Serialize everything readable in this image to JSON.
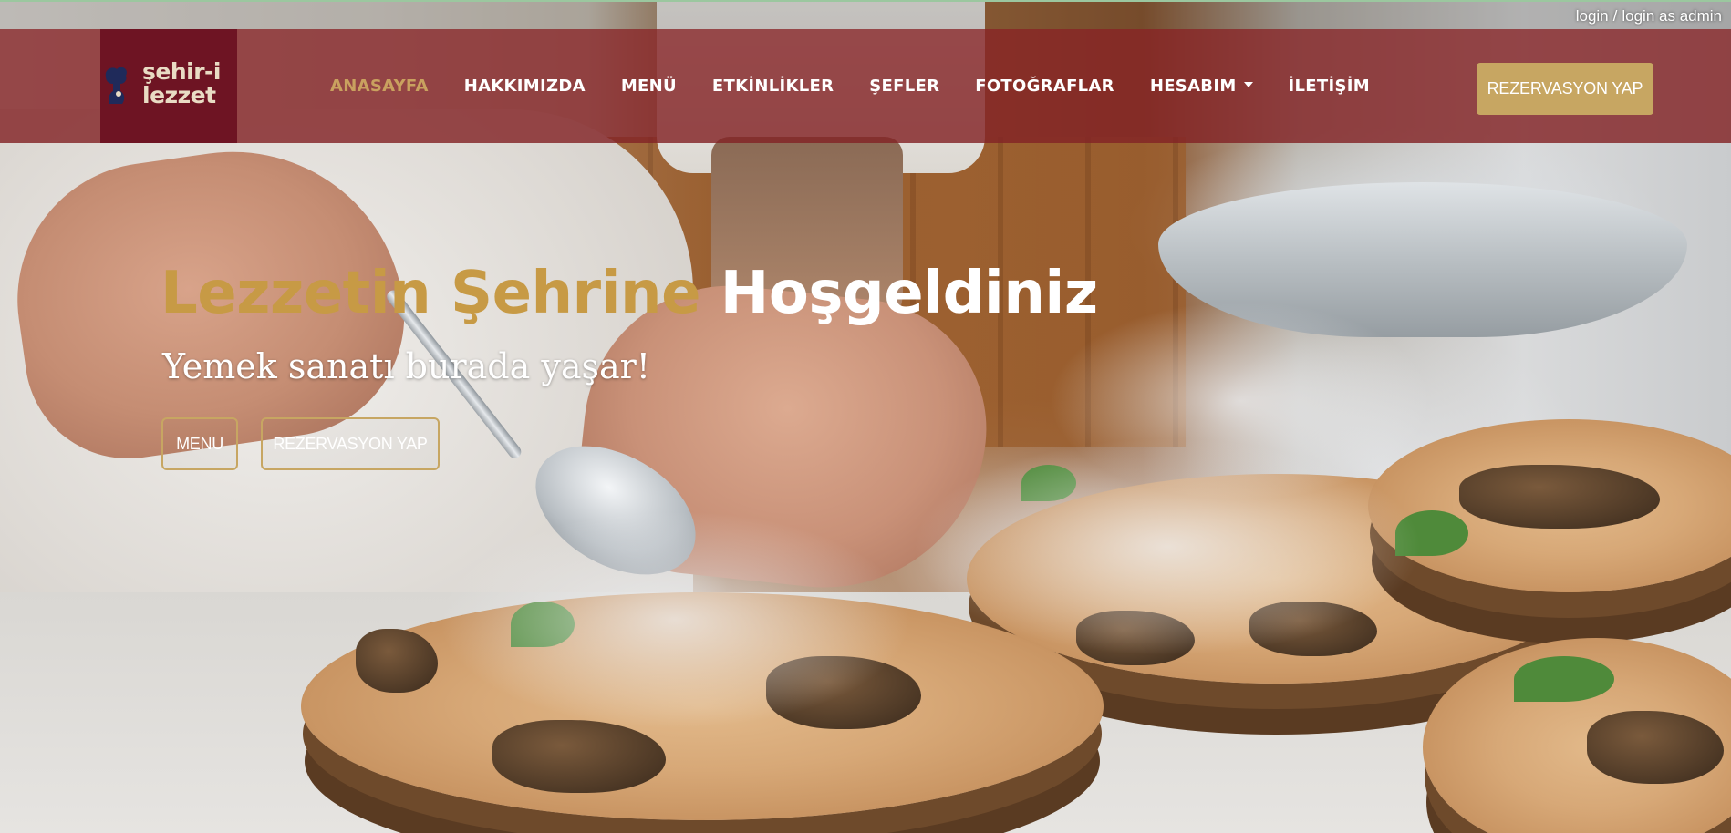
{
  "auth": {
    "login": "login",
    "separator": "/",
    "login_admin": "login as admin"
  },
  "brand": {
    "logo_line1": "şehir-i",
    "logo_line2": "lezzet",
    "logo_icon": "chef-head-icon"
  },
  "nav": {
    "items": [
      {
        "label": "ANASAYFA",
        "active": true
      },
      {
        "label": "HAKKIMIZDA",
        "active": false
      },
      {
        "label": "MENÜ",
        "active": false
      },
      {
        "label": "ETKİNLİKLER",
        "active": false
      },
      {
        "label": "ŞEFLER",
        "active": false
      },
      {
        "label": "FOTOĞRAFLAR",
        "active": false
      },
      {
        "label": "HESABIM",
        "active": false,
        "dropdown": true
      },
      {
        "label": "İLETİŞİM",
        "active": false
      }
    ],
    "cta_label": "REZERVASYON YAP"
  },
  "hero": {
    "title_accent": "Lezzetin Şehrine",
    "title_plain": "Hoşgeldiniz",
    "subtitle": "Yemek sanatı burada yaşar!",
    "btn_menu": "MENU",
    "btn_reserve": "REZERVASYON YAP"
  },
  "colors": {
    "navbar": "#822326",
    "logo_bg": "#6e1423",
    "accent_gold": "#c7a662",
    "active_nav": "#c9a15f"
  }
}
